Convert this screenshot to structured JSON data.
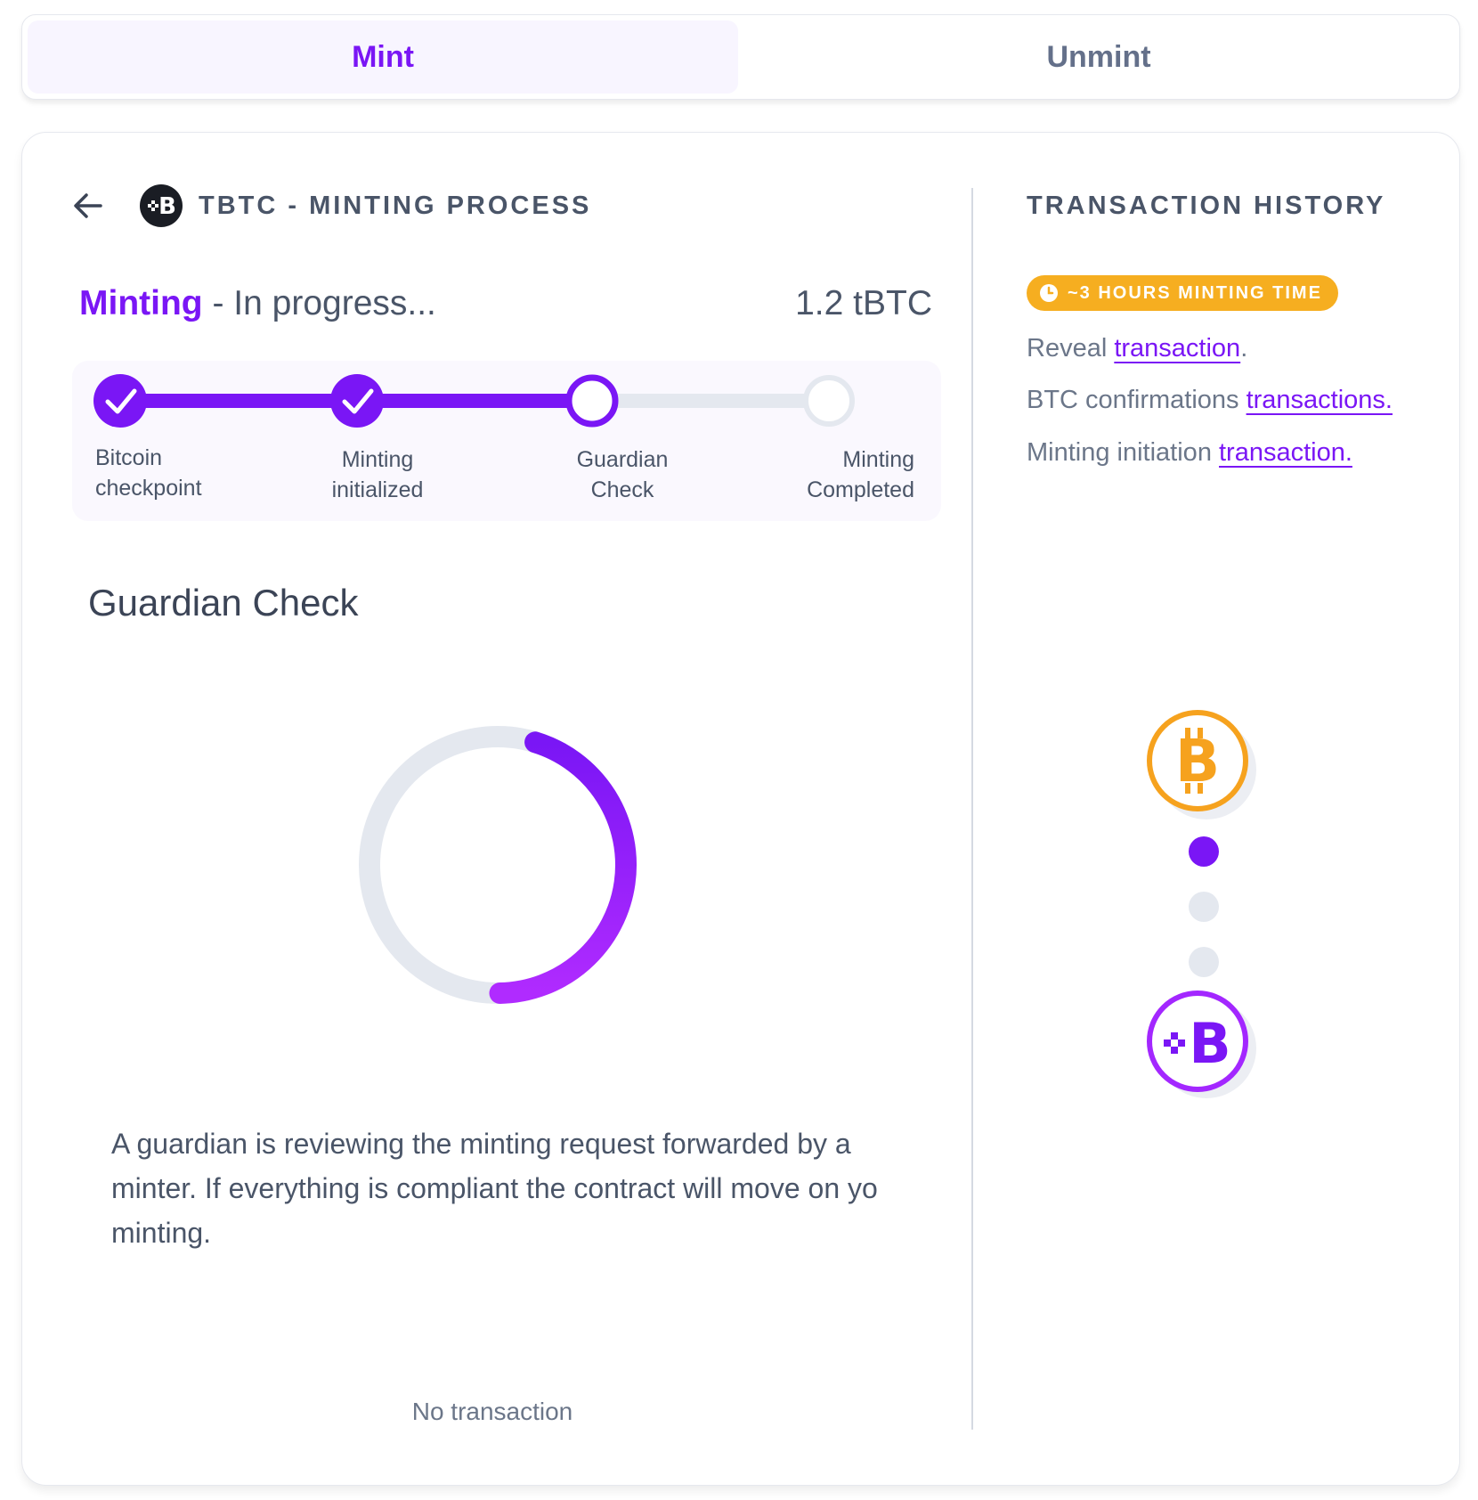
{
  "tabs": [
    {
      "label": "Mint",
      "active": true
    },
    {
      "label": "Unmint",
      "active": false
    }
  ],
  "header": {
    "title": "TBTC - MINTING PROCESS",
    "back_icon": "arrow-left-icon",
    "logo_icon": "tbtc-logo-icon"
  },
  "status": {
    "strong": "Minting",
    "rest": " - In progress...",
    "amount": "1.2 tBTC"
  },
  "stepper": {
    "current_step": 3,
    "steps": [
      {
        "line1": "Bitcoin",
        "line2": "checkpoint",
        "state": "done"
      },
      {
        "line1": "Minting",
        "line2": "initialized",
        "state": "done"
      },
      {
        "line1": "Guardian",
        "line2": "Check",
        "state": "current"
      },
      {
        "line1": "Minting",
        "line2": "Completed",
        "state": "pending"
      }
    ]
  },
  "section": {
    "title": "Guardian Check",
    "progress": 0.45,
    "description": "A guardian is reviewing the minting request forwarded by a minter. If everything is compliant the contract will move on yo minting.",
    "no_transaction": "No transaction"
  },
  "history": {
    "title": "TRANSACTION HISTORY",
    "badge": "~3 HOURS MINTING TIME",
    "items": [
      {
        "text": "Reveal ",
        "link": "transaction",
        "suffix": "."
      },
      {
        "text": "BTC confirmations ",
        "link": "transactions.",
        "suffix": ""
      },
      {
        "text": "Minting initiation ",
        "link": "transaction.",
        "suffix": ""
      }
    ],
    "flow_active_dot": 1
  },
  "colors": {
    "accent": "#7a16f5",
    "accent_light": "#a327ff",
    "bitcoin": "#f6a21e",
    "track": "#e4e8ef"
  },
  "icons": {
    "badge": "clock-icon",
    "coin_top": "bitcoin-coin-icon",
    "coin_bottom": "tbtc-coin-icon"
  }
}
